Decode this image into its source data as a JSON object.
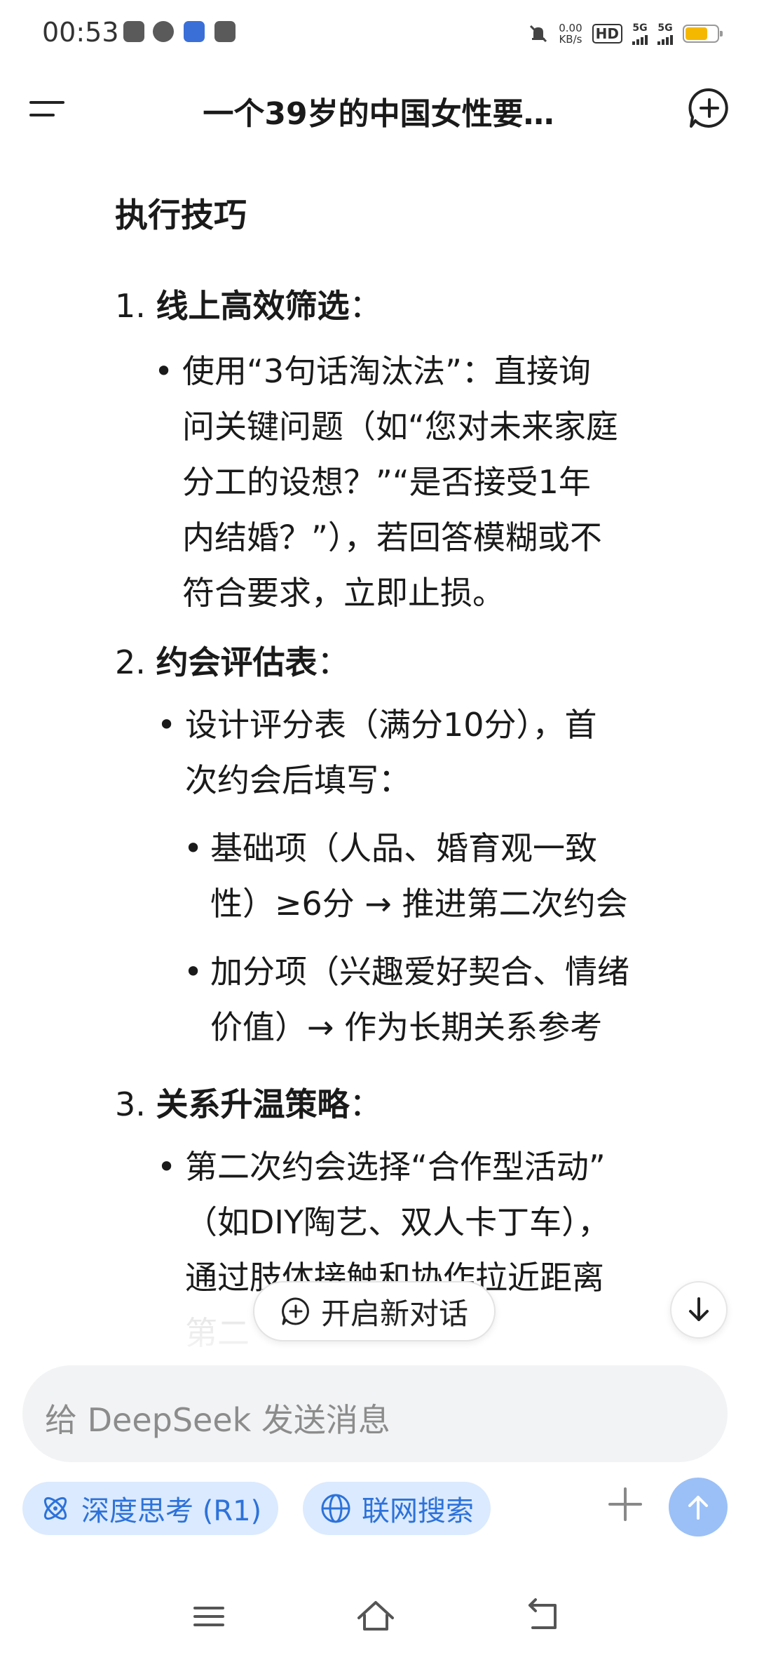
{
  "status_bar": {
    "time": "00:53",
    "net_speed_value": "0.00",
    "net_speed_unit": "KB/s",
    "hd_label": "HD",
    "sim1_label": "5G",
    "sim2_label": "5G",
    "battery_level_pct": 70,
    "battery_color": "#f5b800"
  },
  "header": {
    "title": "一个39岁的中国女性要…"
  },
  "message": {
    "heading": "执行技巧",
    "items": [
      {
        "number": "1.",
        "title": "线上高效筛选",
        "suffix": "：",
        "bullets": [
          {
            "lines": [
              "使用“3句话淘汰法”：直接询",
              "问关键问题（如“您对未来家庭",
              "分工的设想？”“是否接受1年",
              "内结婚？”），若回答模糊或不",
              "符合要求，立即止损。"
            ]
          }
        ]
      },
      {
        "number": "2.",
        "title": "约会评估表",
        "suffix": "：",
        "bullets": [
          {
            "lines": [
              "设计评分表（满分10分），首",
              "次约会后填写："
            ]
          },
          {
            "lines": [
              "基础项（人品、婚育观一致",
              "性）≥6分 → 推进第二次约会"
            ]
          },
          {
            "lines": [
              "加分项（兴趣爱好契合、情绪",
              "价值）→ 作为长期关系参考"
            ]
          }
        ]
      },
      {
        "number": "3.",
        "title": "关系升温策略",
        "suffix": "：",
        "bullets": [
          {
            "lines": [
              "第二次约会选择“合作型活动”",
              "（如DIY陶艺、双人卡丁车），",
              "通过肢体接触和协作拉近距离",
              "第二"
            ]
          }
        ]
      }
    ]
  },
  "floating": {
    "new_conversation_label": "开启新对话"
  },
  "input": {
    "placeholder": "给 DeepSeek 发送消息",
    "deep_think_label": "深度思考 (R1)",
    "web_search_label": "联网搜索"
  },
  "colors": {
    "accent": "#2d72d9",
    "chip_bg": "#dbeafe",
    "send_button": "#9bc0f7",
    "input_bg": "#f2f3f5"
  }
}
